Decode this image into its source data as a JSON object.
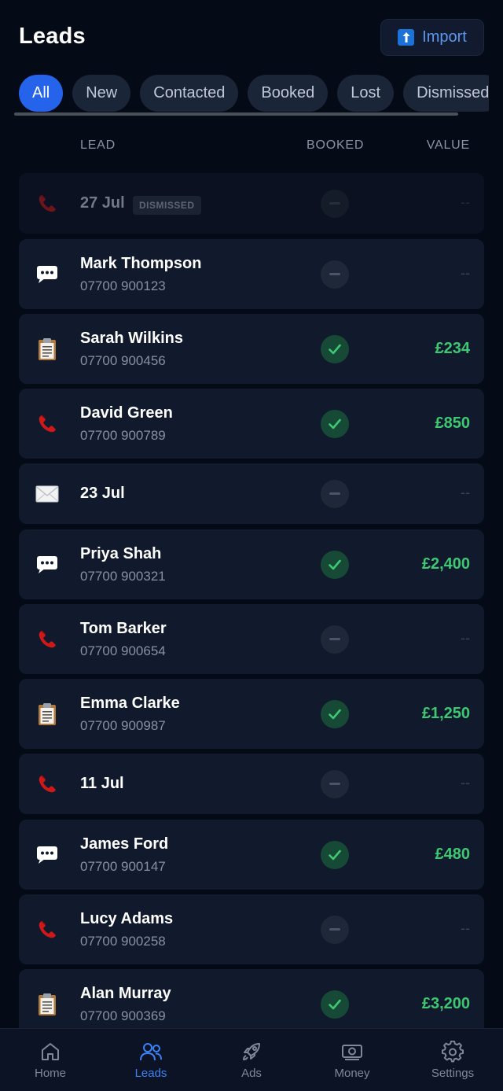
{
  "header": {
    "title": "Leads",
    "import_label": "Import",
    "import_icon": "upload-icon"
  },
  "tabs": [
    {
      "label": "All",
      "active": true
    },
    {
      "label": "New"
    },
    {
      "label": "Contacted"
    },
    {
      "label": "Booked"
    },
    {
      "label": "Lost"
    },
    {
      "label": "Dismissed"
    }
  ],
  "columns": {
    "lead": "LEAD",
    "booked": "BOOKED",
    "value": "VALUE"
  },
  "leads": [
    {
      "icon": "phone-icon",
      "name": "27 Jul",
      "phone": "",
      "badge": "DISMISSED",
      "booked": false,
      "value": "--"
    },
    {
      "icon": "message-icon",
      "name": "Mark Thompson",
      "phone": "07700 900123",
      "booked": false,
      "value": "--"
    },
    {
      "icon": "clipboard-icon",
      "name": "Sarah Wilkins",
      "phone": "07700 900456",
      "booked": true,
      "value": "£234"
    },
    {
      "icon": "phone-icon",
      "name": "David Green",
      "phone": "07700 900789",
      "booked": true,
      "value": "£850"
    },
    {
      "icon": "envelope-icon",
      "name": "23 Jul",
      "phone": "",
      "booked": false,
      "value": "--"
    },
    {
      "icon": "message-icon",
      "name": "Priya Shah",
      "phone": "07700 900321",
      "booked": true,
      "value": "£2,400"
    },
    {
      "icon": "phone-icon",
      "name": "Tom Barker",
      "phone": "07700 900654",
      "booked": false,
      "value": "--"
    },
    {
      "icon": "clipboard-icon",
      "name": "Emma Clarke",
      "phone": "07700 900987",
      "booked": true,
      "value": "£1,250"
    },
    {
      "icon": "phone-icon",
      "name": "11 Jul",
      "phone": "",
      "booked": false,
      "value": "--"
    },
    {
      "icon": "message-icon",
      "name": "James Ford",
      "phone": "07700 900147",
      "booked": true,
      "value": "£480"
    },
    {
      "icon": "phone-icon",
      "name": "Lucy Adams",
      "phone": "07700 900258",
      "booked": false,
      "value": "--"
    },
    {
      "icon": "clipboard-icon",
      "name": "Alan Murray",
      "phone": "07700 900369",
      "booked": true,
      "value": "£3,200"
    }
  ],
  "nav": [
    {
      "label": "Home",
      "icon": "home-icon"
    },
    {
      "label": "Leads",
      "icon": "users-icon",
      "active": true
    },
    {
      "label": "Ads",
      "icon": "rocket-icon"
    },
    {
      "label": "Money",
      "icon": "banknote-icon"
    },
    {
      "label": "Settings",
      "icon": "gear-icon"
    }
  ],
  "colors": {
    "accent": "#2563eb",
    "positive": "#3ec872",
    "background": "#050a17",
    "card": "#111a2c"
  }
}
